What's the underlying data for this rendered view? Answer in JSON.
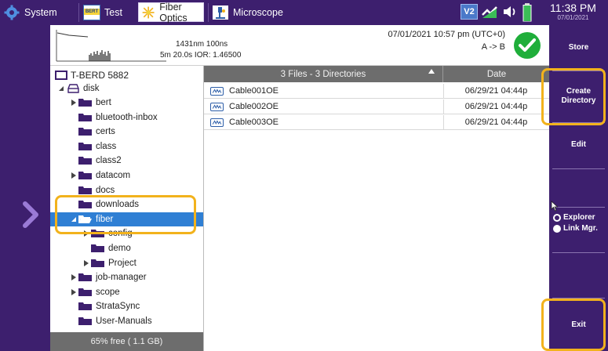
{
  "topbar": {
    "tabs": [
      {
        "label": "System",
        "icon": "gear-icon"
      },
      {
        "label": "Test",
        "icon": "bert-icon",
        "icon_text": "BERT"
      },
      {
        "label": "Fiber Optics",
        "icon": "fiber-star-icon",
        "active": true
      },
      {
        "label": "Microscope",
        "icon": "microscope-icon"
      }
    ],
    "status": {
      "v2_label": "V2",
      "link_icon": "link-status-icon",
      "sound_icon": "speaker-icon",
      "battery_icon": "battery-icon"
    },
    "clock": {
      "time": "11:38 PM",
      "date": "07/01/2021"
    }
  },
  "trace_header": {
    "line1": "1431nm 100ns",
    "line2": "5m  20.0s  IOR: 1.46500",
    "datetime": "07/01/2021 10:57 pm (UTC+0)",
    "direction": "A -> B",
    "result_icon": "pass-check-icon"
  },
  "tree": {
    "root_label": "T-BERD 5882",
    "disk_label": "disk",
    "items": [
      {
        "label": "bert",
        "expandable": true,
        "level": 2
      },
      {
        "label": "bluetooth-inbox",
        "expandable": false,
        "level": 2
      },
      {
        "label": "certs",
        "expandable": false,
        "level": 2
      },
      {
        "label": "class",
        "expandable": false,
        "level": 2
      },
      {
        "label": "class2",
        "expandable": false,
        "level": 2
      },
      {
        "label": "datacom",
        "expandable": true,
        "level": 2
      },
      {
        "label": "docs",
        "expandable": false,
        "level": 2
      },
      {
        "label": "downloads",
        "expandable": false,
        "level": 2
      },
      {
        "label": "fiber",
        "expandable": true,
        "expanded": true,
        "selected": true,
        "level": 2
      },
      {
        "label": "config",
        "expandable": true,
        "level": 3
      },
      {
        "label": "demo",
        "expandable": false,
        "level": 3
      },
      {
        "label": "Project",
        "expandable": true,
        "level": 3
      },
      {
        "label": "job-manager",
        "expandable": true,
        "level": 2
      },
      {
        "label": "scope",
        "expandable": true,
        "level": 2
      },
      {
        "label": "StrataSync",
        "expandable": false,
        "level": 2
      },
      {
        "label": "User-Manuals",
        "expandable": false,
        "level": 2
      }
    ],
    "free_space": "65% free ( 1.1 GB)"
  },
  "file_list": {
    "summary_header": "3 Files - 3 Directories",
    "date_header": "Date",
    "rows": [
      {
        "name": "Cable001OE",
        "date": "06/29/21 04:44p"
      },
      {
        "name": "Cable002OE",
        "date": "06/29/21 04:44p"
      },
      {
        "name": "Cable003OE",
        "date": "06/29/21 04:44p"
      }
    ]
  },
  "softkeys": {
    "store": "Store",
    "create_directory": "Create Directory",
    "edit": "Edit",
    "explorer": "Explorer",
    "link_mgr": "Link Mgr.",
    "exit": "Exit"
  },
  "colors": {
    "chrome_purple": "#3d1f6e",
    "selection_blue": "#2f7fd4",
    "highlight_orange": "#f2b21c",
    "header_gray": "#6d6d6d",
    "pass_green": "#1fae3a"
  }
}
